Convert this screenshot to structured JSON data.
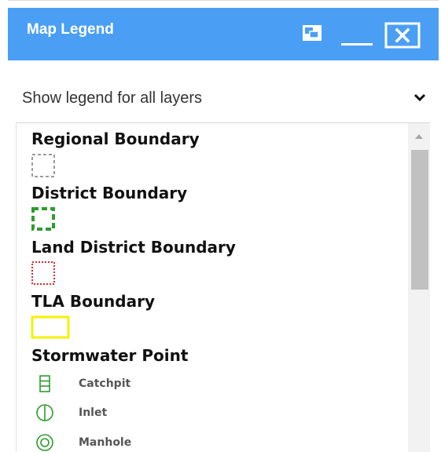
{
  "panel": {
    "title": "Map Legend",
    "header_color": "#4a9ff5",
    "buttons": [
      {
        "name": "restore",
        "icon": "restore-window-icon"
      },
      {
        "name": "minimize",
        "icon": "minimize-icon"
      },
      {
        "name": "close",
        "icon": "close-icon"
      }
    ]
  },
  "dropdown": {
    "selected": "Show legend for all layers",
    "icon": "chevron-down-icon"
  },
  "layers": [
    {
      "title": "Regional Boundary",
      "symbol": {
        "style": "dashed",
        "color": "#9a9a9a"
      }
    },
    {
      "title": "District Boundary",
      "symbol": {
        "style": "dashed",
        "color": "#2e9b2e"
      }
    },
    {
      "title": "Land District Boundary",
      "symbol": {
        "style": "dotted",
        "color": "#e0262f"
      }
    },
    {
      "title": "TLA Boundary",
      "symbol": {
        "style": "solid",
        "color": "#f5f100"
      }
    },
    {
      "title": "Stormwater Point",
      "items": [
        {
          "label": "Catchpit",
          "icon": "catchpit-icon",
          "color": "#2e9b2e"
        },
        {
          "label": "Inlet",
          "icon": "inlet-icon",
          "color": "#2e9b2e"
        },
        {
          "label": "Manhole",
          "icon": "manhole-icon",
          "color": "#2e9b2e"
        }
      ]
    }
  ]
}
